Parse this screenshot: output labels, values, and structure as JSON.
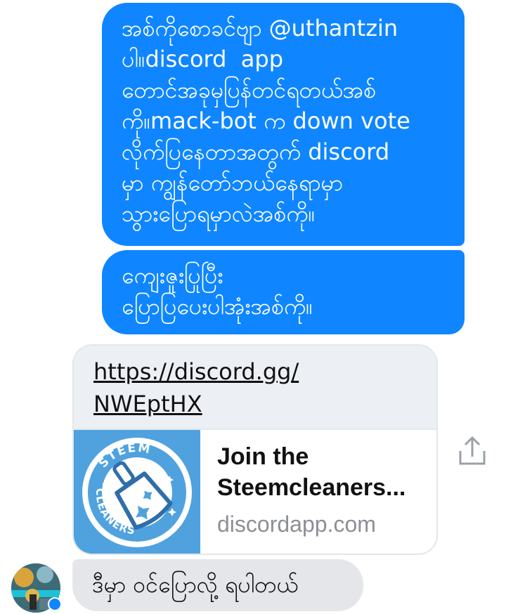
{
  "messages": {
    "outgoing_1": "အစ်ကိုစောခင်ဗျာ @uthantzin\nပါ။discord  app\nတောင်အခုမှပြန်တင်ရတယ်အစ်\nကို။mack-bot က down vote\nလိုက်ပြနေတာအတွက် discord\nမှာ ကျွန်တော်ဘယ်နေရာမှာ\nသွားပြောရမှာလဲအစ်ကို။",
    "outgoing_2": "ကျေးဇူးပြုပြီး\nပြောပြပေးပါအုံးအစ်ကို။",
    "incoming_1": "ဒီမှာ ဝင်ပြောလို့ ရပါတယ်"
  },
  "link_card": {
    "url": "https://discord.gg/\nNWEptHX",
    "title": "Join the\nSteemcleaners...",
    "domain": "discordapp.com",
    "thumbnail": {
      "logo_top_text": "STEEM",
      "logo_bottom_text": "CLEANERS",
      "background": "#4fa2de"
    }
  },
  "icons": {
    "share": "share-icon",
    "avatar": "avatar",
    "messenger_badge": "messenger-badge-icon"
  },
  "colors": {
    "outgoing_bubble": "#0f86ff",
    "incoming_bubble": "#e4e6ea",
    "link_url_area": "#eceff3"
  }
}
